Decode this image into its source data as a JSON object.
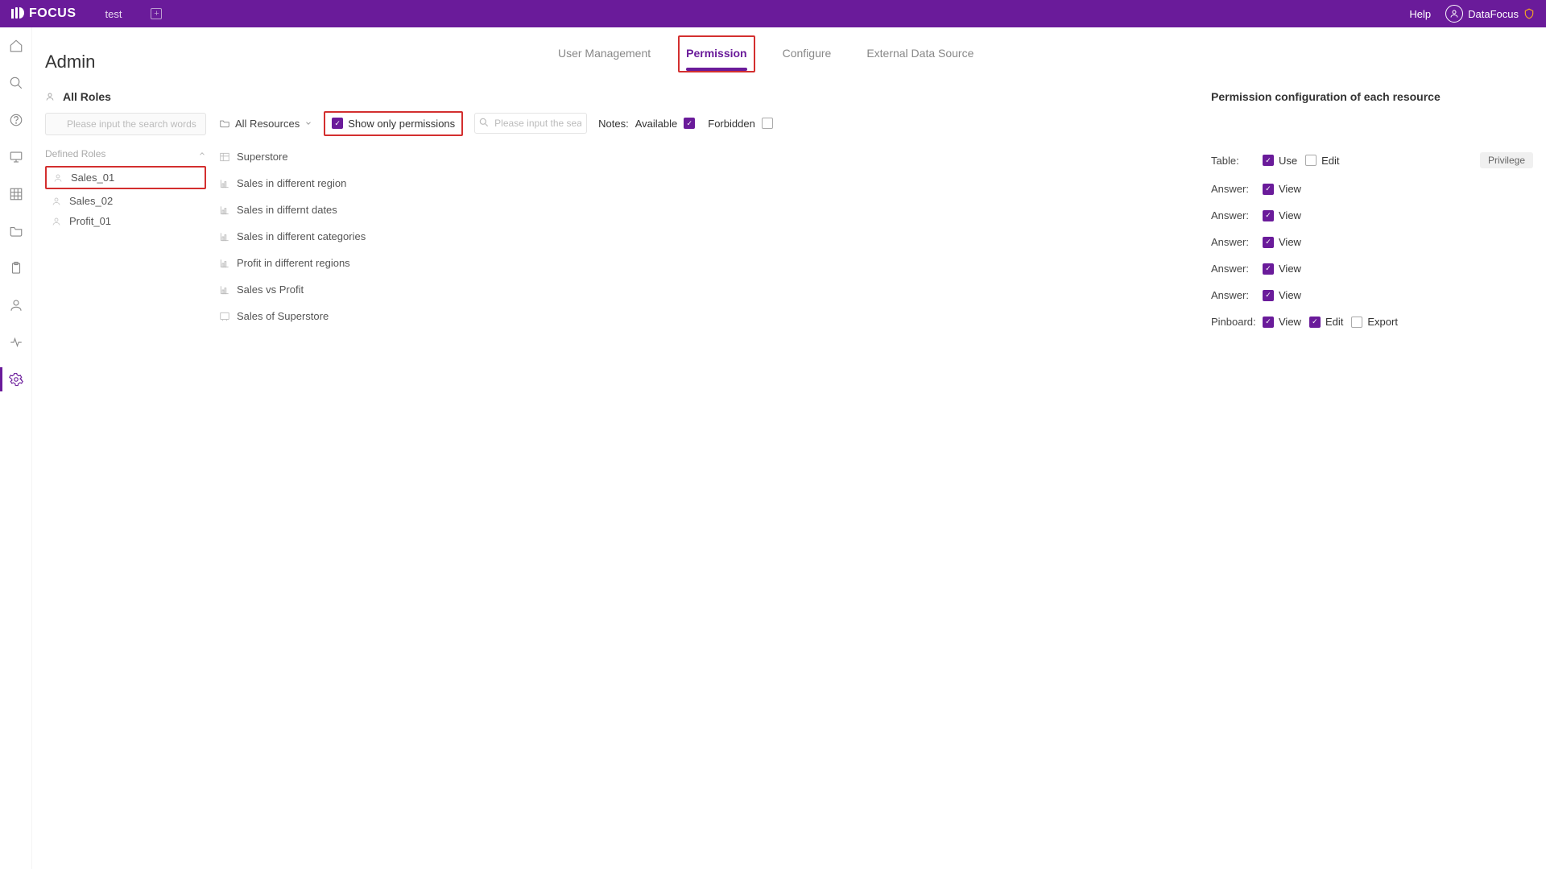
{
  "topbar": {
    "logo": "FOCUS",
    "tabLabel": "test",
    "help": "Help",
    "username": "DataFocus"
  },
  "page": {
    "title": "Admin",
    "tabs": [
      {
        "label": "User Management",
        "active": false
      },
      {
        "label": "Permission",
        "active": true
      },
      {
        "label": "Configure",
        "active": false
      },
      {
        "label": "External Data Source",
        "active": false
      }
    ]
  },
  "roles": {
    "header": "All Roles",
    "searchPlaceholder": "Please input the search words",
    "groupLabel": "Defined Roles",
    "items": [
      {
        "name": "Sales_01",
        "selected": true
      },
      {
        "name": "Sales_02",
        "selected": false
      },
      {
        "name": "Profit_01",
        "selected": false
      }
    ]
  },
  "resources": {
    "dropdown": "All Resources",
    "showOnlyLabel": "Show only permissions",
    "searchPlaceholder": "Please input the search w",
    "notesLabel": "Notes:",
    "availableLabel": "Available",
    "forbiddenLabel": "Forbidden",
    "items": [
      {
        "icon": "table",
        "name": "Superstore"
      },
      {
        "icon": "chart",
        "name": "Sales in different region"
      },
      {
        "icon": "chart",
        "name": "Sales in differnt dates"
      },
      {
        "icon": "chart",
        "name": "Sales in different categories"
      },
      {
        "icon": "chart",
        "name": "Profit in different regions"
      },
      {
        "icon": "chart",
        "name": "Sales vs Profit"
      },
      {
        "icon": "pinboard",
        "name": "Sales of Superstore"
      }
    ]
  },
  "permPanel": {
    "header": "Permission configuration of each resource",
    "rows": [
      {
        "type": "Table:",
        "opts": [
          {
            "label": "Use",
            "checked": true
          },
          {
            "label": "Edit",
            "checked": false
          }
        ],
        "privilege": true
      },
      {
        "type": "Answer:",
        "opts": [
          {
            "label": "View",
            "checked": true
          }
        ]
      },
      {
        "type": "Answer:",
        "opts": [
          {
            "label": "View",
            "checked": true
          }
        ]
      },
      {
        "type": "Answer:",
        "opts": [
          {
            "label": "View",
            "checked": true
          }
        ]
      },
      {
        "type": "Answer:",
        "opts": [
          {
            "label": "View",
            "checked": true
          }
        ]
      },
      {
        "type": "Answer:",
        "opts": [
          {
            "label": "View",
            "checked": true
          }
        ]
      },
      {
        "type": "Pinboard:",
        "opts": [
          {
            "label": "View",
            "checked": true
          },
          {
            "label": "Edit",
            "checked": true
          },
          {
            "label": "Export",
            "checked": false
          }
        ]
      }
    ],
    "privilegeLabel": "Privilege"
  }
}
